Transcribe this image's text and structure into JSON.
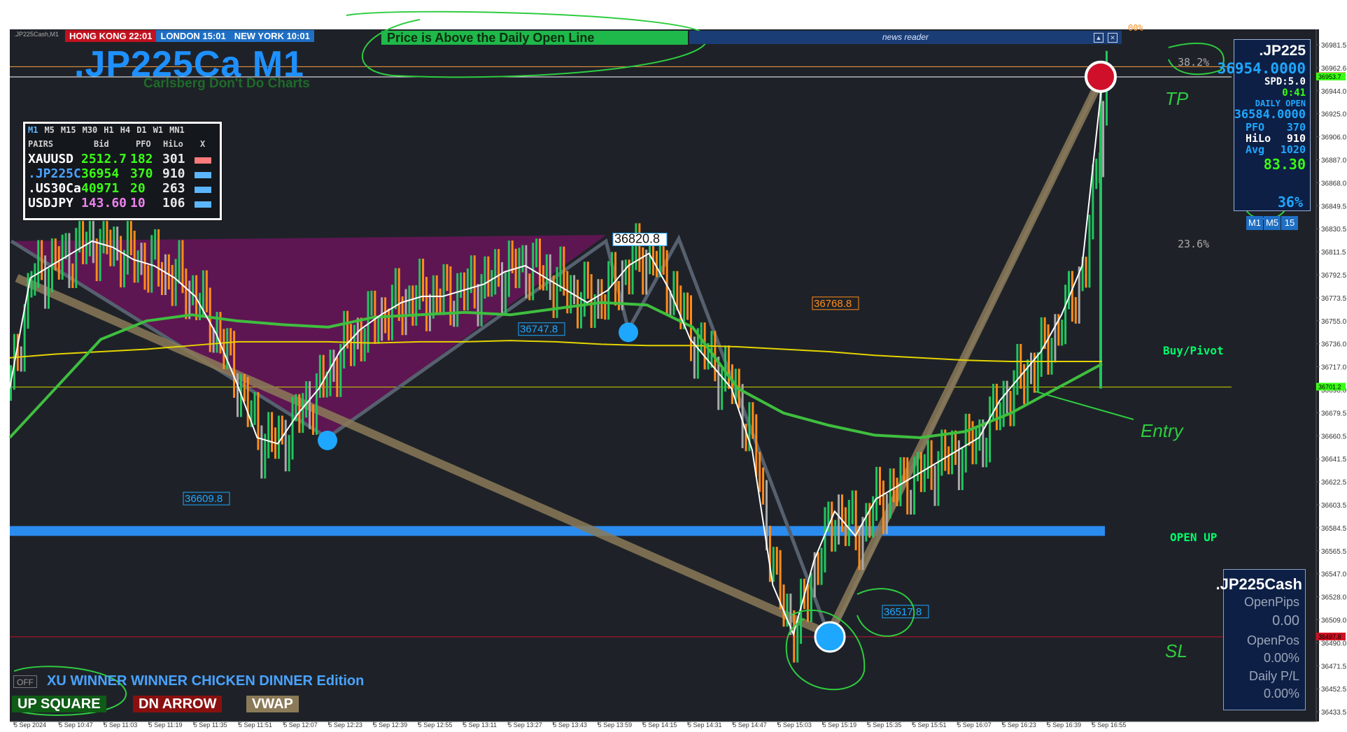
{
  "window": {
    "symbol_tag": ".JP225Cash,M1",
    "title": ".JP225Ca M1",
    "subtitle": "Carlsberg Don't Do Charts"
  },
  "clocks": [
    {
      "label": "HONG KONG 22:01",
      "color": "#c1121f"
    },
    {
      "label": "LONDON  15:01",
      "color": "#1f6fc4"
    },
    {
      "label": "NEW YORK 10:01",
      "color": "#1f6fc4"
    }
  ],
  "status_banner": "Price is Above the Daily Open Line",
  "news_reader": {
    "label": "news reader",
    "btn_min": "▲",
    "btn_close": "✕"
  },
  "pairs_panel": {
    "timeframes": [
      "M1",
      "M5",
      "M15",
      "M30",
      "H1",
      "H4",
      "D1",
      "W1",
      "MN1"
    ],
    "headers": [
      "PAIRS",
      "Bid",
      "PFO",
      "HiLo",
      "X"
    ],
    "rows": [
      {
        "pair": "XAUUSD",
        "bid": "2512.7",
        "pfo": "182",
        "hilo": "301",
        "pair_color": "#ffffff",
        "bid_color": "#39ff14",
        "pfo_color": "#39ff14"
      },
      {
        "pair": ".JP225C",
        "bid": "36954",
        "pfo": "370",
        "hilo": "910",
        "pair_color": "#4aa3ff",
        "bid_color": "#39ff14",
        "pfo_color": "#39ff14"
      },
      {
        "pair": ".US30Ca",
        "bid": "40971",
        "pfo": "20",
        "hilo": "263",
        "pair_color": "#ffffff",
        "bid_color": "#39ff14",
        "pfo_color": "#39ff14"
      },
      {
        "pair": "USDJPY",
        "bid": "143.60",
        "pfo": "10",
        "hilo": "106",
        "pair_color": "#ffffff",
        "bid_color": "#ee82ee",
        "pfo_color": "#ee82ee"
      }
    ]
  },
  "info_panel": {
    "symbol": ".JP225",
    "price": "36954.0000",
    "spread": "SPD:5.0",
    "timer": "0:41",
    "daily_open_label": "DAILY OPEN",
    "daily_open": "36584.0000",
    "pfo_label": "PFO",
    "pfo": "370",
    "hilo_label": "HiLo",
    "hilo": "910",
    "avg_label": "Avg",
    "avg": "1020",
    "value": "83.30",
    "tf_buttons": [
      "M1",
      "M5",
      "15"
    ],
    "percent": "36%"
  },
  "position_panel": {
    "symbol": ".JP225Cash",
    "open_pips_label": "OpenPips",
    "open_pips": "0.00",
    "open_pos_label": "OpenPos",
    "open_pos": "0.00%",
    "daily_pl_label": "Daily P/L",
    "daily_pl": "0.00%"
  },
  "side_labels": {
    "buy_pivot": "Buy/Pivot",
    "open_up": "OPEN UP",
    "fib_382": "38.2%",
    "fib_236": "23.6%",
    "fib_top": "00%"
  },
  "annotations": {
    "tp": "TP",
    "entry": "Entry",
    "sl": "SL"
  },
  "bottom": {
    "off_button": "OFF",
    "edition": "XU WINNER WINNER CHICKEN DINNER Edition",
    "buttons": [
      {
        "label": "UP SQUARE",
        "color": "#0f5c16"
      },
      {
        "label": "DN ARROW",
        "color": "#8a1010"
      },
      {
        "label": "VWAP",
        "color": "#8b7a58"
      }
    ]
  },
  "colors": {
    "background": "#1e2228",
    "bull_bar": "#22c55e",
    "bear_bar": "#ff8c1a",
    "neutral_bar": "#a9a9a9",
    "daily_open_band": "#2b8cf0"
  },
  "chart_data": {
    "type": "candlestick",
    "symbol": ".JP225Cash",
    "timeframe": "M1",
    "y_ticks": [
      "36981.5",
      "36962.6",
      "36944.0",
      "36925.0",
      "36906.0",
      "36887.0",
      "36868.0",
      "36849.5",
      "36830.5",
      "36811.5",
      "36792.5",
      "36773.5",
      "36755.0",
      "36736.0",
      "36717.0",
      "36698.0",
      "36679.5",
      "36660.5",
      "36641.5",
      "36622.5",
      "36603.5",
      "36584.5",
      "36565.5",
      "36547.0",
      "36528.0",
      "36509.0",
      "36490.0",
      "36471.5",
      "36452.5",
      "36433.5"
    ],
    "x_ticks": [
      "5 Sep 2024",
      "5 Sep 10:47",
      "5 Sep 11:03",
      "5 Sep 11:19",
      "5 Sep 11:35",
      "5 Sep 11:51",
      "5 Sep 12:07",
      "5 Sep 12:23",
      "5 Sep 12:39",
      "5 Sep 12:55",
      "5 Sep 13:11",
      "5 Sep 13:27",
      "5 Sep 13:43",
      "5 Sep 13:59",
      "5 Sep 14:15",
      "5 Sep 14:31",
      "5 Sep 14:47",
      "5 Sep 15:03",
      "5 Sep 15:19",
      "5 Sep 15:35",
      "5 Sep 15:51",
      "5 Sep 16:07",
      "5 Sep 16:23",
      "5 Sep 16:39",
      "5 Sep 16:55"
    ],
    "ylim": [
      36430,
      36985
    ],
    "price_labels": [
      {
        "value": "36954.0",
        "color": "#ff4040"
      },
      {
        "value": "36953.7",
        "color": "#39ff14"
      },
      {
        "value": "36701.2",
        "color": "#39ff14"
      },
      {
        "value": "36497.8",
        "color": "#d01020"
      }
    ],
    "level_labels": [
      {
        "text": "36820.8",
        "value": 36820.8
      },
      {
        "text": "36747.8",
        "value": 36747.8
      },
      {
        "text": "36768.8",
        "value": 36768.8
      },
      {
        "text": "36517.8",
        "value": 36517.8
      },
      {
        "text": "36609.8",
        "value": 36609.8
      }
    ],
    "horizontal_lines": {
      "daily_open": 36584.0,
      "pivot": 36701.2,
      "stop": 36497.8,
      "top": 36962.0,
      "top2": 36953.7
    },
    "close_path": [
      36700,
      36790,
      36800,
      36810,
      36820,
      36815,
      36805,
      36800,
      36790,
      36775,
      36745,
      36705,
      36660,
      36655,
      36680,
      36700,
      36730,
      36748,
      36760,
      36770,
      36775,
      36775,
      36780,
      36785,
      36795,
      36800,
      36790,
      36780,
      36770,
      36780,
      36800,
      36810,
      36780,
      36740,
      36720,
      36700,
      36650,
      36540,
      36500,
      36560,
      36600,
      36580,
      36610,
      36620,
      36630,
      36640,
      36650,
      36660,
      36690,
      36710,
      36730,
      36760,
      36800,
      36955
    ],
    "zigzag": [
      36820,
      36660,
      36820,
      36748,
      36822,
      36497,
      36954
    ],
    "ma_slow": [
      36725,
      36728,
      36730,
      36732,
      36735,
      36738,
      36738,
      36738,
      36737,
      36738,
      36738,
      36739,
      36738,
      36736,
      36735,
      36735,
      36734,
      36732,
      36730,
      36727,
      36725,
      36723,
      36722,
      36722,
      36722
    ],
    "ma_mid": [
      36660,
      36700,
      36740,
      36755,
      36760,
      36755,
      36752,
      36750,
      36758,
      36760,
      36762,
      36760,
      36765,
      36770,
      36768,
      36750,
      36700,
      36680,
      36670,
      36662,
      36660,
      36665,
      36680,
      36700,
      36720
    ],
    "up_arrows": [
      36660,
      36748,
      36500
    ],
    "down_arrows": [
      36955
    ]
  }
}
